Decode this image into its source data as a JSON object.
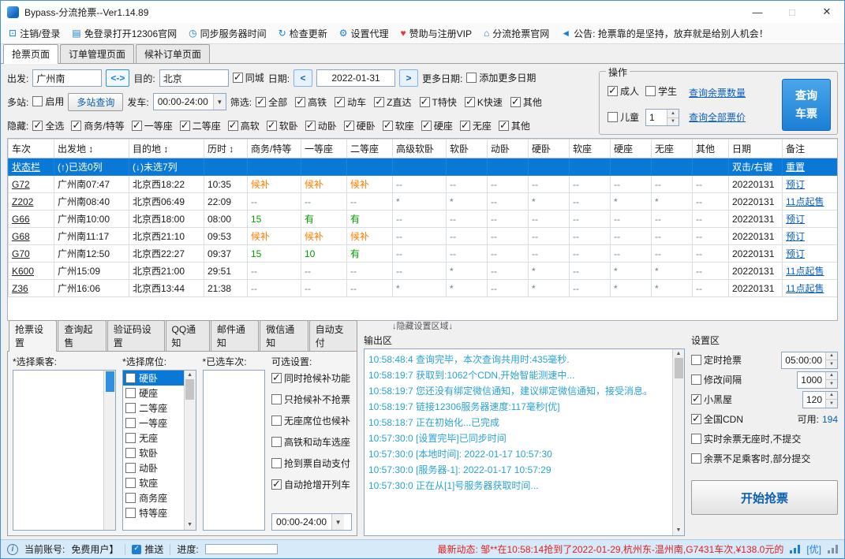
{
  "window": {
    "title": "Bypass-分流抢票--Ver1.14.89",
    "minimize": "—",
    "maximize": "□",
    "close": "✕"
  },
  "menu": {
    "items": [
      {
        "name": "logout-login",
        "glyph": "⊡",
        "label": "注销/登录"
      },
      {
        "name": "open-12306-site",
        "glyph": "▤",
        "label": "免登录打开12306官网"
      },
      {
        "name": "sync-server-time",
        "glyph": "◷",
        "label": "同步服务器时间"
      },
      {
        "name": "check-update",
        "glyph": "↻",
        "label": "检查更新"
      },
      {
        "name": "set-proxy",
        "glyph": "⚙",
        "label": "设置代理"
      },
      {
        "name": "sponsor-vip",
        "glyph": "♥",
        "label": "赞助与注册VIP",
        "color": "#e03c3c"
      },
      {
        "name": "official-site",
        "glyph": "⌂",
        "label": "分流抢票官网"
      },
      {
        "name": "announcement",
        "glyph": "◄",
        "label": "公告: 抢票靠的是坚持，放弃就是给别人机会！"
      }
    ]
  },
  "main_tabs": [
    {
      "name": "grab-page",
      "label": "抢票页面",
      "active": true
    },
    {
      "name": "order-manage-page",
      "label": "订单管理页面"
    },
    {
      "name": "waitlist-order-page",
      "label": "候补订单页面"
    }
  ],
  "query": {
    "depart_label": "出发:",
    "depart_value": "广州南",
    "swap": "<->",
    "dest_label": "目的:",
    "dest_value": "北京",
    "same_city": {
      "label": "同城",
      "checked": true
    },
    "date_label": "日期:",
    "date_prev": "<",
    "date_value": "2022-01-31",
    "date_next": ">",
    "more_dates_label": "更多日期:",
    "more_dates_cb": {
      "label": "添加更多日期",
      "checked": false
    },
    "multi_label": "多站:",
    "multi_enable": {
      "label": "启用",
      "checked": false
    },
    "multi_btn": "多站查询",
    "depart_time_label": "发车:",
    "depart_time_value": "00:00-24:00",
    "filter_label": "筛选:",
    "filters": [
      {
        "label": "全部",
        "checked": true
      },
      {
        "label": "高铁",
        "checked": true
      },
      {
        "label": "动车",
        "checked": true
      },
      {
        "label": "Z直达",
        "checked": true
      },
      {
        "label": "T特快",
        "checked": true
      },
      {
        "label": "K快速",
        "checked": true
      },
      {
        "label": "其他",
        "checked": true
      }
    ],
    "hide_label": "隐藏:",
    "hide_filters": [
      {
        "label": "全选",
        "checked": true
      },
      {
        "label": "商务/特等",
        "checked": true
      },
      {
        "label": "一等座",
        "checked": true
      },
      {
        "label": "二等座",
        "checked": true
      },
      {
        "label": "高软",
        "checked": true
      },
      {
        "label": "软卧",
        "checked": true
      },
      {
        "label": "动卧",
        "checked": true
      },
      {
        "label": "硬卧",
        "checked": true
      },
      {
        "label": "软座",
        "checked": true
      },
      {
        "label": "硬座",
        "checked": true
      },
      {
        "label": "无座",
        "checked": true
      },
      {
        "label": "其他",
        "checked": true
      }
    ]
  },
  "operation": {
    "legend": "操作",
    "adult": {
      "label": "成人",
      "checked": true
    },
    "student": {
      "label": "学生",
      "checked": false
    },
    "child": {
      "label": "儿童",
      "checked": false
    },
    "child_count": "1",
    "link_remaining": "查询余票数量",
    "link_prices": "查询全部票价",
    "query_btn_line1": "查询",
    "query_btn_line2": "车票"
  },
  "table": {
    "columns": [
      "车次",
      "出发地 ↕",
      "目的地 ↕",
      "历时 ↕",
      "商务/特等",
      "一等座",
      "二等座",
      "高级软卧",
      "软卧",
      "动卧",
      "硬卧",
      "软座",
      "硬座",
      "无座",
      "其他",
      "日期",
      "备注"
    ],
    "rows": [
      {
        "selected": true,
        "cells": [
          "状态栏",
          "(↑)已选0列",
          "(↓)未选7列",
          "",
          "",
          "",
          "",
          "",
          "",
          "",
          "",
          "",
          "",
          "",
          "",
          "双击/右键",
          "重置"
        ]
      },
      {
        "cells": [
          "G72",
          "广州南07:47",
          "北京西18:22",
          "10:35",
          "候补",
          "候补",
          "候补",
          "--",
          "--",
          "--",
          "--",
          "--",
          "--",
          "--",
          "--",
          "20220131",
          "预订"
        ]
      },
      {
        "cells": [
          "Z202",
          "广州南08:40",
          "北京西06:49",
          "22:09",
          "--",
          "--",
          "--",
          "*",
          "*",
          "--",
          "*",
          "--",
          "*",
          "*",
          "--",
          "20220131",
          "11点起售"
        ]
      },
      {
        "cells": [
          "G66",
          "广州南10:00",
          "北京西18:00",
          "08:00",
          "15",
          "有",
          "有",
          "--",
          "--",
          "--",
          "--",
          "--",
          "--",
          "--",
          "--",
          "20220131",
          "预订"
        ]
      },
      {
        "cells": [
          "G68",
          "广州南11:17",
          "北京西21:10",
          "09:53",
          "候补",
          "候补",
          "候补",
          "--",
          "--",
          "--",
          "--",
          "--",
          "--",
          "--",
          "--",
          "20220131",
          "预订"
        ]
      },
      {
        "cells": [
          "G70",
          "广州南12:50",
          "北京西22:27",
          "09:37",
          "15",
          "10",
          "有",
          "--",
          "--",
          "--",
          "--",
          "--",
          "--",
          "--",
          "--",
          "20220131",
          "预订"
        ]
      },
      {
        "cells": [
          "K600",
          "广州15:09",
          "北京西21:00",
          "29:51",
          "--",
          "--",
          "--",
          "--",
          "*",
          "--",
          "*",
          "--",
          "*",
          "*",
          "--",
          "20220131",
          "11点起售"
        ]
      },
      {
        "cells": [
          "Z36",
          "广州16:06",
          "北京西13:44",
          "21:38",
          "--",
          "--",
          "--",
          "*",
          "*",
          "--",
          "*",
          "--",
          "*",
          "*",
          "--",
          "20220131",
          "11点起售"
        ]
      }
    ]
  },
  "divider": "↓隐藏设置区域↓",
  "bottom_tabs": [
    {
      "name": "grab-settings",
      "label": "抢票设置",
      "active": true
    },
    {
      "name": "presale-query",
      "label": "查询起售"
    },
    {
      "name": "captcha-settings",
      "label": "验证码设置"
    },
    {
      "name": "qq-notify",
      "label": "QQ通知"
    },
    {
      "name": "email-notify",
      "label": "邮件通知"
    },
    {
      "name": "wechat-notify",
      "label": "微信通知"
    },
    {
      "name": "auto-pay",
      "label": "自动支付"
    }
  ],
  "passengers": {
    "label": "*选择乘客:"
  },
  "seats": {
    "label": "*选择席位:",
    "items": [
      {
        "label": "硬卧",
        "checked": false,
        "selected": true
      },
      {
        "label": "硬座",
        "checked": false
      },
      {
        "label": "二等座",
        "checked": false
      },
      {
        "label": "一等座",
        "checked": false
      },
      {
        "label": "无座",
        "checked": false
      },
      {
        "label": "软卧",
        "checked": false
      },
      {
        "label": "动卧",
        "checked": false
      },
      {
        "label": "软座",
        "checked": false
      },
      {
        "label": "商务座",
        "checked": false
      },
      {
        "label": "特等座",
        "checked": false
      }
    ]
  },
  "selected_trains": {
    "label": "*已选车次:"
  },
  "options": {
    "label": "可选设置:",
    "items": [
      {
        "label": "同时抢候补功能",
        "checked": true
      },
      {
        "label": "只抢候补不抢票",
        "checked": false
      },
      {
        "label": "无座席位也候补",
        "checked": false
      },
      {
        "label": "高铁和动车选座",
        "checked": false
      },
      {
        "label": "抢到票自动支付",
        "checked": false
      },
      {
        "label": "自动抢增开列车",
        "checked": true
      }
    ],
    "time_range": "00:00-24:00"
  },
  "output": {
    "label": "输出区",
    "lines": [
      "10:58:48:4  查询完毕，本次查询共用时:435毫秒.",
      "10:58:19:7  获取到:1062个CDN,开始智能测速中...",
      "10:58:19:7  您还没有绑定微信通知，建议绑定微信通知，接受消息。",
      "10:58:19:7  链接12306服务器速度:117毫秒[优]",
      "10:58:18:7  正在初始化...已完成",
      "10:57:30:0  [设置完毕]已同步时间",
      "10:57:30:0  [本地时间]: 2022-01-17 10:57:30",
      "10:57:30:0  [服务器-1]:  2022-01-17 10:57:29",
      "10:57:30:0  正在从[1]号服务器获取时间..."
    ]
  },
  "settings": {
    "label": "设置区",
    "rows": [
      {
        "label": "定时抢票",
        "checked": false,
        "spinner": true,
        "value": "05:00:00"
      },
      {
        "label": "修改间隔",
        "checked": false,
        "spinner": true,
        "value": "1000"
      },
      {
        "label": "小黑屋",
        "checked": true,
        "spinner": true,
        "value": "120"
      },
      {
        "label": "全国CDN",
        "checked": true,
        "suffix_label": "可用:",
        "suffix_value": "194"
      },
      {
        "label": "实时余票无座时,不提交",
        "checked": false
      },
      {
        "label": "余票不足乘客时,部分提交",
        "checked": false
      }
    ],
    "start_btn": "开始抢票"
  },
  "statusbar": {
    "account_label": "当前账号:",
    "account_value": "免费用户】",
    "push_label": "推送",
    "progress_label": "进度:",
    "news_label": "最新动态:",
    "news_text": "邹**在10:58:14抢到了2022-01-29,杭州东-温州南,G7431车次,¥138.0元的",
    "net_quality": "[优]"
  },
  "colors": {
    "accent": "#1b7fd4",
    "selected_row": "#0a78d7",
    "waitlist": "#ff7f00",
    "available": "#00a000",
    "link": "#0a5fbf",
    "log": "#2aa3d4",
    "news": "#e02020"
  }
}
